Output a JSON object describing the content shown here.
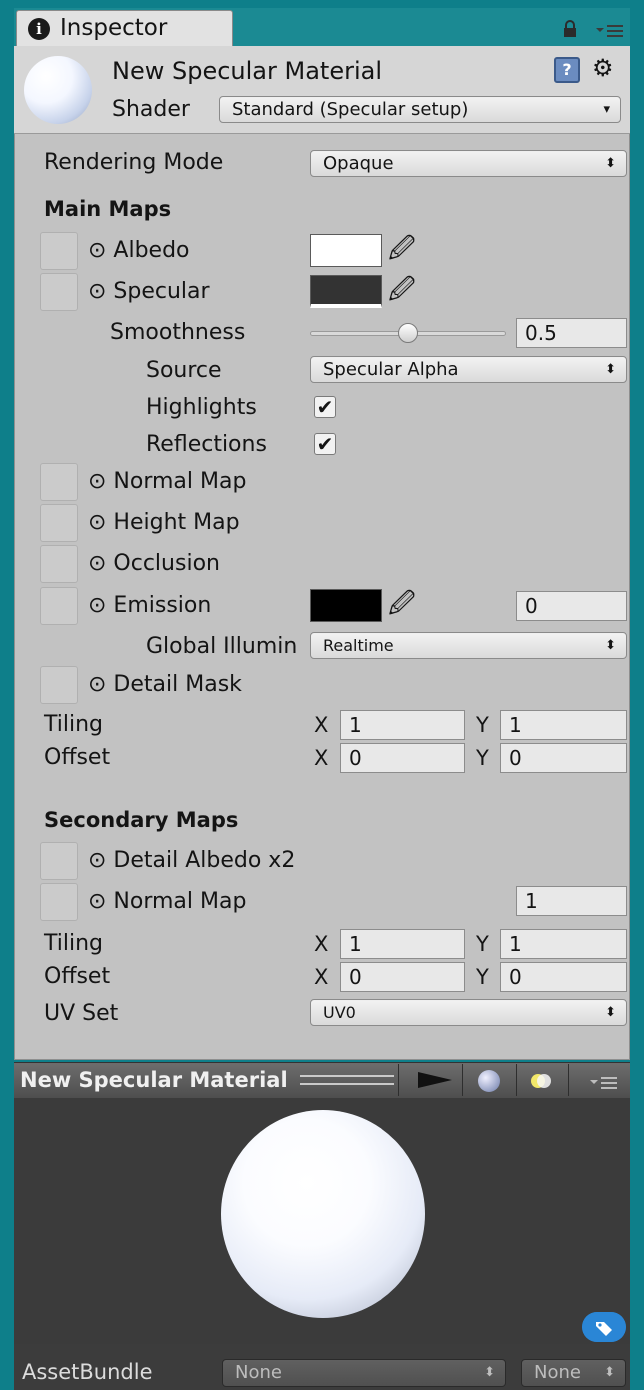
{
  "tab": {
    "icon": "info-icon",
    "icon_glyph": "i",
    "title": "Inspector"
  },
  "header": {
    "material_name": "New Specular Material",
    "shader_label": "Shader",
    "shader_value": "Standard (Specular setup)",
    "help_glyph": "?",
    "settings_glyph": "⚙"
  },
  "rendering_mode": {
    "label": "Rendering Mode",
    "value": "Opaque"
  },
  "main_maps": {
    "title": "Main Maps",
    "albedo_label": "⊙ Albedo",
    "albedo_color": "#ffffff",
    "specular_label": "⊙ Specular",
    "specular_color": "#333333",
    "smoothness_label": "Smoothness",
    "smoothness_value": "0.5",
    "smoothness_level": 0.5,
    "source_label": "Source",
    "source_value": "Specular Alpha",
    "highlights_label": "Highlights",
    "highlights_checked": "✔",
    "reflections_label": "Reflections",
    "reflections_checked": "✔",
    "normal_map_label": "⊙ Normal Map",
    "height_map_label": "⊙ Height Map",
    "occlusion_label": "⊙ Occlusion",
    "emission_label": "⊙ Emission",
    "emission_color": "#000000",
    "emission_value": "0",
    "global_illum_label": "Global Illumin",
    "global_illum_value": "Realtime",
    "detail_mask_label": "⊙ Detail Mask",
    "tiling_label": "Tiling",
    "tiling_x": "1",
    "tiling_y": "1",
    "offset_label": "Offset",
    "offset_x": "0",
    "offset_y": "0"
  },
  "secondary_maps": {
    "title": "Secondary Maps",
    "detail_albedo_label": "⊙ Detail Albedo x2",
    "normal_map_label": "⊙ Normal Map",
    "normal_map_value": "1",
    "tiling_label": "Tiling",
    "tiling_x": "1",
    "tiling_y": "1",
    "offset_label": "Offset",
    "offset_x": "0",
    "offset_y": "0",
    "uv_set_label": "UV Set",
    "uv_set_value": "UV0"
  },
  "axis": {
    "x": "X",
    "y": "Y"
  },
  "preview": {
    "title": "New Specular Material"
  },
  "asset_bundle": {
    "label": "AssetBundle",
    "name_value": "None",
    "variant_value": "None"
  },
  "dropdown_arrow": "▾",
  "dropdown_updown": "⬍"
}
